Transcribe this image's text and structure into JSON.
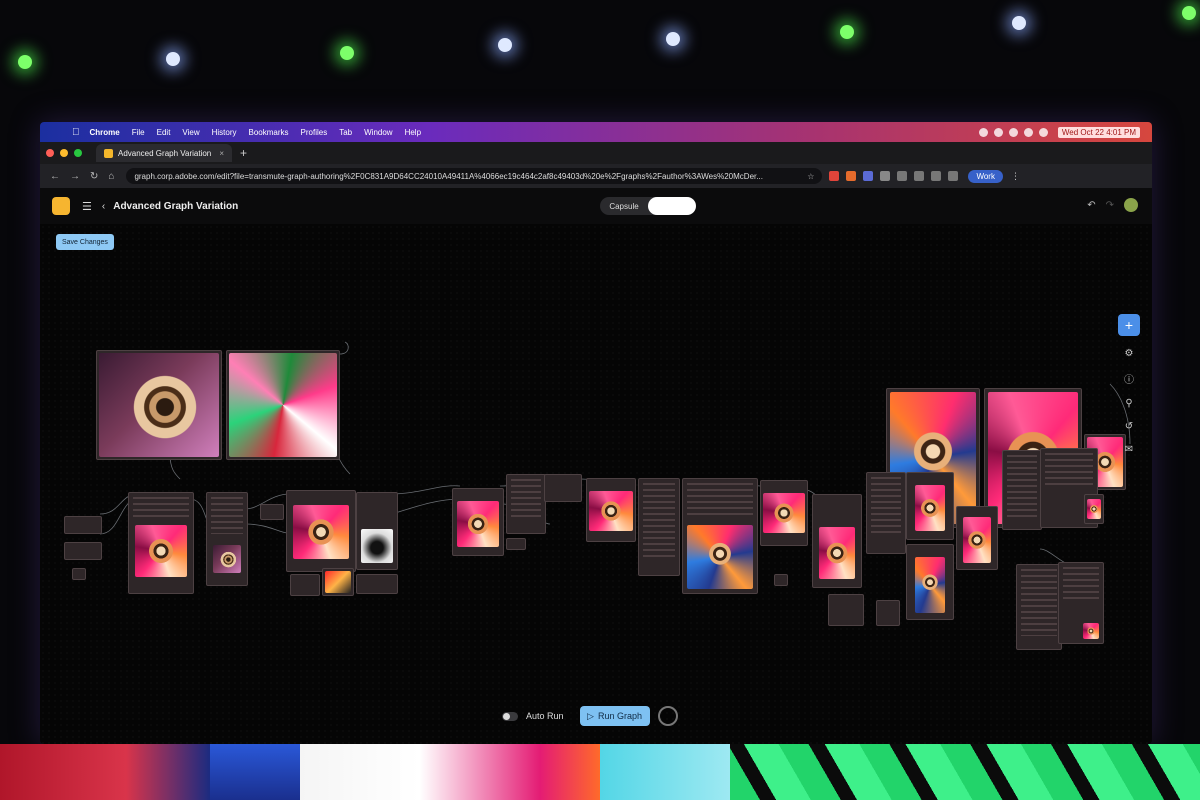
{
  "menubar": {
    "app": "Chrome",
    "items": [
      "File",
      "Edit",
      "View",
      "History",
      "Bookmarks",
      "Profiles",
      "Tab",
      "Window",
      "Help"
    ],
    "clock": "Wed Oct 22  4:01 PM"
  },
  "browser": {
    "tab_title": "Advanced Graph Variation",
    "url": "graph.corp.adobe.com/edit?file=transmute-graph-authoring%2F0C831A9D64CC24010A49411A%4066ec19c464c2af8c49403d%20e%2Fgraphs%2Fauthor%3AWes%20McDer...",
    "profile": "Work"
  },
  "app": {
    "title": "Advanced Graph Variation",
    "view_toggle": [
      "Capsule",
      ""
    ],
    "save_label": "Save Changes"
  },
  "icons": {
    "right_tools": [
      "add-node-icon",
      "sliders-icon",
      "info-icon",
      "search-icon",
      "history-icon",
      "chat-icon"
    ]
  },
  "run": {
    "auto_run_label": "Auto Run",
    "run_label": "Run Graph"
  },
  "colors": {
    "accent": "#4b8fe8",
    "run_button": "#7ec1f2",
    "node_bg": "#2e2628"
  }
}
